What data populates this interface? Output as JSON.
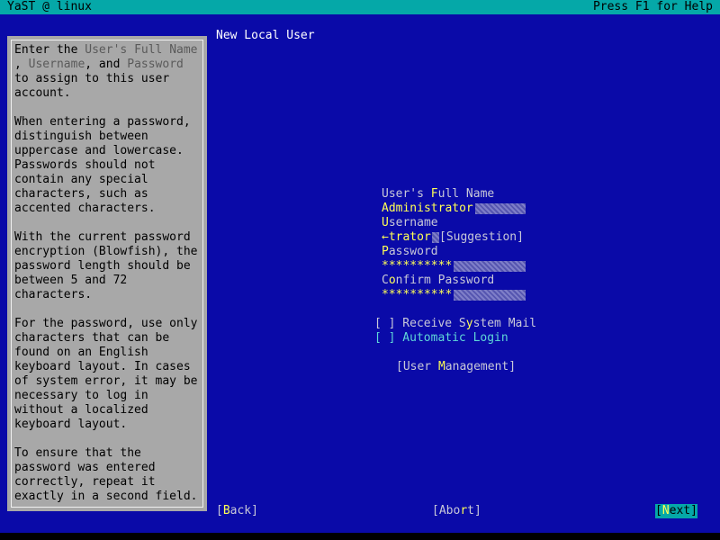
{
  "titlebar": {
    "left": "YaST @ linux",
    "right": "Press F1 for Help"
  },
  "dialog": {
    "title": "New Local User"
  },
  "help": {
    "lines": [
      [
        "Enter the ",
        {
          "hl": "User's Full Name"
        }
      ],
      [
        ", ",
        {
          "hl": "Username"
        },
        ", and ",
        {
          "hl": "Password"
        }
      ],
      [
        "to assign to this user"
      ],
      [
        "account."
      ],
      [
        ""
      ],
      [
        "When entering a password,"
      ],
      [
        "distinguish between"
      ],
      [
        "uppercase and lowercase."
      ],
      [
        "Passwords should not"
      ],
      [
        "contain any special"
      ],
      [
        "characters, such as"
      ],
      [
        "accented characters."
      ],
      [
        ""
      ],
      [
        "With the current password"
      ],
      [
        "encryption (Blowfish), the"
      ],
      [
        "password length should be"
      ],
      [
        "between 5 and 72"
      ],
      [
        "characters."
      ],
      [
        ""
      ],
      [
        "For the password, use only"
      ],
      [
        "characters that can be"
      ],
      [
        "found on an English"
      ],
      [
        "keyboard layout. In cases"
      ],
      [
        "of system error, it may be"
      ],
      [
        "necessary to log in"
      ],
      [
        "without a localized"
      ],
      [
        "keyboard layout."
      ],
      [
        ""
      ],
      [
        "To ensure that the"
      ],
      [
        "password was entered"
      ],
      [
        "correctly, repeat it"
      ],
      [
        "exactly in a second field."
      ]
    ]
  },
  "form": {
    "full_name_label_pre": "User's ",
    "full_name_label_hot": "F",
    "full_name_label_post": "ull Name",
    "full_name_value": "Administrator",
    "username_label_hot": "U",
    "username_label_post": "sername",
    "username_value": "←trator",
    "suggestion_label": "[Suggestion]",
    "password_label_hot": "P",
    "password_label_post": "assword",
    "password_value": "**********",
    "confirm_label_pre": "C",
    "confirm_label_hot": "o",
    "confirm_label_post": "nfirm Password",
    "confirm_value": "**********"
  },
  "checks": {
    "receive_mail_pre": "[ ] Receive S",
    "receive_mail_hot": "y",
    "receive_mail_post": "stem Mail",
    "auto_login": "[ ] Automatic Login"
  },
  "buttons": {
    "user_mgmt_pre": "[User ",
    "user_mgmt_hot": "M",
    "user_mgmt_post": "anagement]",
    "back_pre": "[",
    "back_hot": "B",
    "back_post": "ack]",
    "abort_pre": "[Abo",
    "abort_hot": "r",
    "abort_post": "t]",
    "next_pre": "[",
    "next_hot": "N",
    "next_post": "ext]"
  },
  "colors": {
    "background": "#0a0aa8",
    "titlebar": "#05a8a8",
    "hotkey": "#ffff55",
    "help_bg": "#a8a8a8"
  }
}
